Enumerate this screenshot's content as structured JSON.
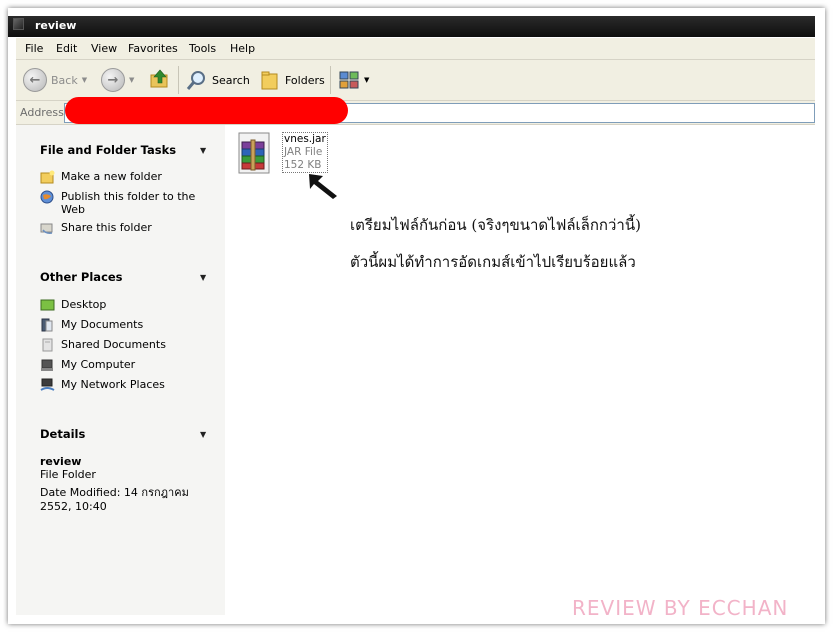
{
  "window": {
    "title": "review"
  },
  "menu": [
    "File",
    "Edit",
    "View",
    "Favorites",
    "Tools",
    "Help"
  ],
  "toolbar": {
    "back": "Back",
    "search": "Search",
    "folders": "Folders"
  },
  "address": {
    "label": "Address"
  },
  "sidebar": {
    "file_tasks": {
      "title": "File and Folder Tasks",
      "items": [
        "Make a new folder",
        "Publish this folder to the Web",
        "Share this folder"
      ]
    },
    "other_places": {
      "title": "Other Places",
      "items": [
        "Desktop",
        "My Documents",
        "Shared Documents",
        "My Computer",
        "My Network Places"
      ]
    },
    "details": {
      "title": "Details",
      "name": "review",
      "type": "File Folder",
      "modified": "Date Modified: 14 กรกฎาคม 2552, 10:40"
    }
  },
  "file": {
    "name": "vnes.jar",
    "type": "JAR File",
    "size": "152 KB"
  },
  "annotation": {
    "line1": "เตรียมไฟล์กันก่อน (จริงๆขนาดไฟล์เล็กกว่านี้)",
    "line2": "ตัวนี้ผมได้ทำการอัดเกมส์เข้าไปเรียบร้อยแล้ว"
  },
  "watermark": "REVIEW BY ECCHAN",
  "icons": {
    "back": "back-arrow-icon",
    "forward": "forward-arrow-icon",
    "up": "folder-up-icon",
    "search": "search-icon",
    "folders": "folders-icon",
    "views": "views-icon",
    "file": "winrar-archive-icon",
    "annotation": "arrow-pointer-icon"
  },
  "colors": {
    "title_bar": "#1a1a1a",
    "redaction": "#ff0000",
    "watermark": "#f2b3c8",
    "task_pane": "#f5f5f3"
  }
}
